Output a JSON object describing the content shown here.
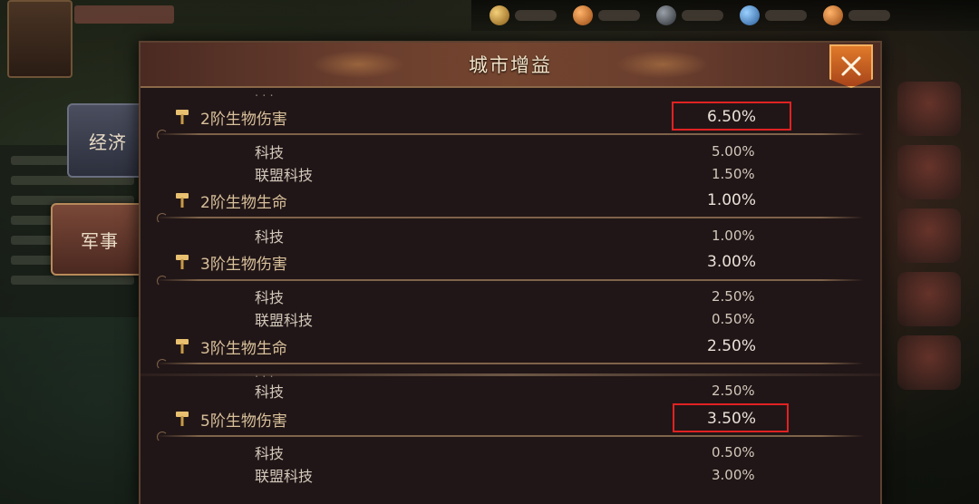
{
  "dialog": {
    "title": "城市增益"
  },
  "tabs": {
    "economy": "经济",
    "military": "军事"
  },
  "list": {
    "rows": [
      {
        "type": "category",
        "label": "2阶生物伤害",
        "value": "6.50%"
      },
      {
        "type": "sub",
        "label": "科技",
        "value": "5.00%"
      },
      {
        "type": "sub",
        "label": "联盟科技",
        "value": "1.50%"
      },
      {
        "type": "category",
        "label": "2阶生物生命",
        "value": "1.00%"
      },
      {
        "type": "sub",
        "label": "科技",
        "value": "1.00%"
      },
      {
        "type": "category",
        "label": "3阶生物伤害",
        "value": "3.00%"
      },
      {
        "type": "sub",
        "label": "科技",
        "value": "2.50%"
      },
      {
        "type": "sub",
        "label": "联盟科技",
        "value": "0.50%"
      },
      {
        "type": "category",
        "label": "3阶生物生命",
        "value": "2.50%"
      },
      {
        "type": "sub",
        "label": "科技",
        "value": "2.50%"
      },
      {
        "type": "category",
        "label": "5阶生物伤害",
        "value": "3.50%"
      },
      {
        "type": "sub",
        "label": "科技",
        "value": "0.50%"
      },
      {
        "type": "sub",
        "label": "联盟科技",
        "value": "3.00%"
      }
    ]
  },
  "colors": {
    "highlight": "#e02222",
    "category_text": "#d8c09a",
    "close_button": "#e07a2a"
  },
  "icons": {
    "close": "close-icon",
    "category": "hammer-icon"
  }
}
